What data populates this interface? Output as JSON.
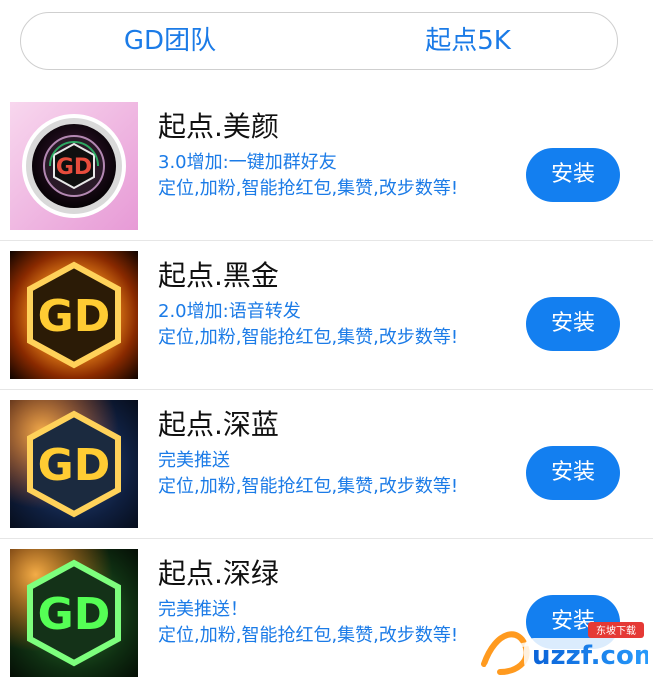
{
  "tabs": [
    {
      "label": "GD团队"
    },
    {
      "label": "起点5K"
    }
  ],
  "apps": [
    {
      "title": "起点.美颜",
      "desc1": "3.0增加:一键加群好友",
      "desc2": "定位,加粉,智能抢红包,集赞,改步数等!",
      "install_label": "安装"
    },
    {
      "title": "起点.黑金",
      "desc1": "2.0增加:语音转发",
      "desc2": "定位,加粉,智能抢红包,集赞,改步数等!",
      "install_label": "安装"
    },
    {
      "title": "起点.深蓝",
      "desc1": "完美推送",
      "desc2": "定位,加粉,智能抢红包,集赞,改步数等!",
      "install_label": "安装"
    },
    {
      "title": "起点.深绿",
      "desc1": "完美推送！",
      "desc2": "定位,加粉,智能抢红包,集赞,改步数等!",
      "install_label": "安装"
    }
  ],
  "watermark": {
    "brand": "uzzf.com",
    "tagline": "东坡下载"
  },
  "colors": {
    "accent": "#1b7be7",
    "button": "#137ff0"
  }
}
